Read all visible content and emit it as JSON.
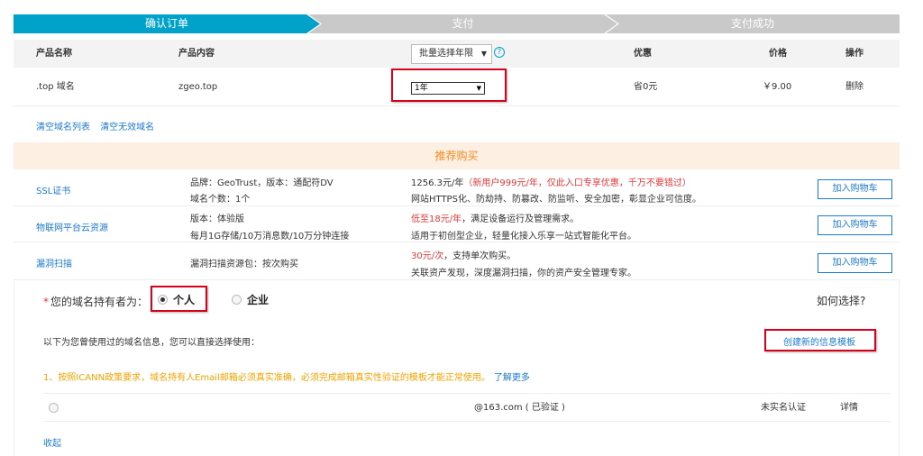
{
  "steps": [
    "确认订单",
    "支付",
    "支付成功"
  ],
  "order": {
    "headers": {
      "product_name": "产品名称",
      "product_content": "产品内容",
      "batch_select": "批量选择年限",
      "discount": "优惠",
      "price": "价格",
      "action": "操作"
    },
    "row": {
      "name": ".top 域名",
      "content": "zgeo.top",
      "years": "1年",
      "discount": "省0元",
      "price": "￥9.00",
      "action": "删除"
    },
    "clear_list": "清空域名列表",
    "clear_invalid": "清空无效域名"
  },
  "recommend": {
    "title": "推荐购买",
    "items": [
      {
        "name": "SSL证书",
        "spec1": "品牌：GeoTrust，版本：通配符DV",
        "spec2": "域名个数：1个",
        "price_prefix": "1256.3元/年",
        "price_promo": "（新用户999元/年，仅此入口专享优惠，千万不要错过）",
        "desc": "网站HTTPS化、防劫持、防篡改、防监听、安全加密，彰显企业可信度。",
        "button": "加入购物车"
      },
      {
        "name": "物联网平台云资源",
        "spec1": "版本：体验版",
        "spec2": "每月1G存储/10万消息数/10万分钟连接",
        "price_promo": "低至18元/年",
        "price_suffix": "，满足设备运行及管理需求。",
        "desc": "适用于初创型企业，轻量化接入乐享一站式智能化平台。",
        "button": "加入购物车"
      },
      {
        "name": "漏洞扫描",
        "spec1": "漏洞扫描资源包：按次购买",
        "price_promo": "30元/次",
        "price_suffix": "，支持单次购买。",
        "desc": "关联资产发现，深度漏洞扫描，你的资产安全管理专家。",
        "button": "加入购物车"
      }
    ]
  },
  "holder": {
    "required_mark": "*",
    "label": "您的域名持有者为：",
    "option_personal": "个人",
    "option_company": "企业",
    "how_to_choose": "如何选择?",
    "info_text": "以下为您曾使用过的域名信息，您可以直接选择使用：",
    "new_template": "创建新的信息模板",
    "warning": "1、按照ICANN政策要求，域名持有人Email邮箱必须真实准确，必须完成邮箱真实性验证的模板才能正常使用。",
    "learn_more": "了解更多",
    "template": {
      "email": "@163.com ( 已验证 )",
      "status": "未实名认证",
      "details": "详情"
    },
    "collapse": "收起"
  }
}
